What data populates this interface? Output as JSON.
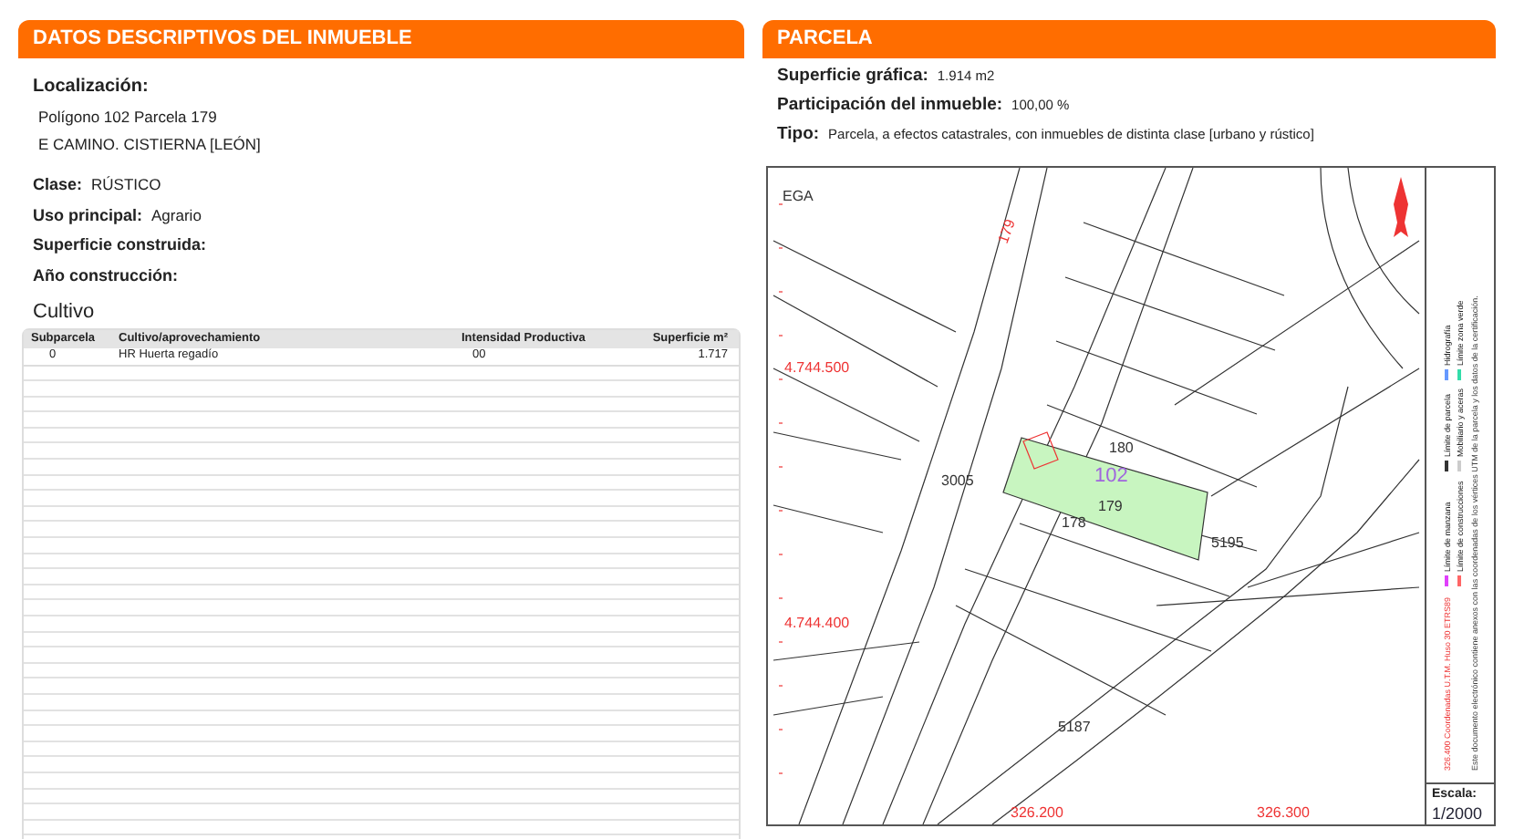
{
  "descriptive": {
    "title": "DATOS DESCRIPTIVOS DEL INMUEBLE",
    "location_label": "Localización:",
    "location_lines": [
      "Polígono 102 Parcela 179",
      "E CAMINO. CISTIERNA [LEÓN]"
    ],
    "fields": [
      {
        "label": "Clase:",
        "value": "RÚSTICO"
      },
      {
        "label": "Uso principal:",
        "value": "Agrario"
      },
      {
        "label": "Superficie construida:"
      },
      {
        "label": "Año construcción:"
      }
    ],
    "crops": {
      "title": "Cultivo",
      "columns": [
        "Subparcela",
        "Cultivo/aprovechamiento",
        "Intensidad Productiva",
        "Superficie m²"
      ],
      "rows": [
        [
          "0",
          "HR Huerta regadío",
          "00",
          "1.717"
        ]
      ]
    }
  },
  "parcel": {
    "title": "PARCELA",
    "fields": [
      {
        "label": "Superficie gráfica:",
        "value": "1.914 m2"
      },
      {
        "label": "Participación del inmueble:",
        "value": "100,00 %"
      },
      {
        "label": "Tipo:",
        "value": "Parcela, a efectos catastrales, con inmuebles de distinta clase [urbano y rústico]"
      }
    ],
    "map": {
      "labels": [
        {
          "kind": "grid",
          "text": "EGA"
        },
        {
          "kind": "coord",
          "text": "4.744.500"
        },
        {
          "kind": "coord",
          "text": "4.744.400"
        },
        {
          "kind": "coord",
          "text": "179"
        },
        {
          "kind": "plot",
          "text": "180"
        },
        {
          "kind": "polygon",
          "text": "102"
        },
        {
          "kind": "plot",
          "text": "179"
        },
        {
          "kind": "plot",
          "text": "178"
        },
        {
          "kind": "plot",
          "text": "3005"
        },
        {
          "kind": "plot",
          "text": "5195"
        },
        {
          "kind": "plot",
          "text": "5187"
        },
        {
          "kind": "coord",
          "text": "326.200"
        },
        {
          "kind": "coord",
          "text": "326.300"
        }
      ],
      "legend": [
        {
          "text": "Límite de manzana",
          "color": "#e040fb"
        },
        {
          "text": "Límite de parcela",
          "color": "#333333"
        },
        {
          "text": "Hidrografía",
          "color": "#6699ff"
        },
        {
          "text": "Límite de construcciones",
          "color": "#ff6666"
        },
        {
          "text": "Mobiliario y aceras",
          "color": "#cccccc"
        },
        {
          "text": "Límite zona verde",
          "color": "#33ddaa"
        }
      ],
      "coordinates_note": "326.400 Coordenadas U.T.M. Huso 30 ETRS89",
      "note": "Este documento electrónico contiene anexos con las coordenadas de los vértices UTM de la parcela y los datos de la certificación.",
      "scale_label": "Escala:",
      "scale": "1/2000"
    }
  }
}
